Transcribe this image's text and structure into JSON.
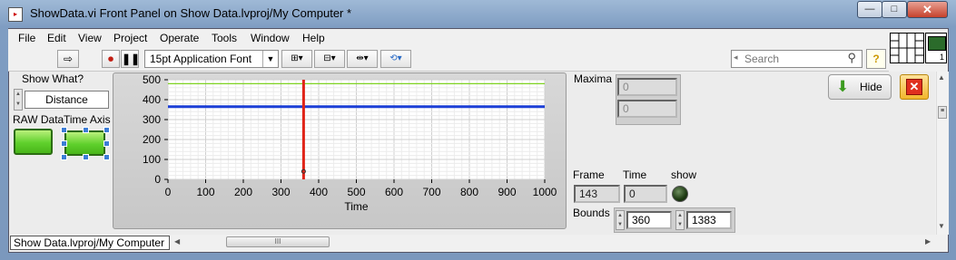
{
  "window": {
    "title": "ShowData.vi Front Panel on Show Data.lvproj/My Computer *",
    "min_glyph": "—",
    "max_glyph": "□",
    "close_glyph": "✕"
  },
  "menu": [
    "File",
    "Edit",
    "View",
    "Project",
    "Operate",
    "Tools",
    "Window",
    "Help"
  ],
  "toolbar": {
    "font_label": "15pt Application Font",
    "search_placeholder": "Search",
    "help_glyph": "?"
  },
  "vi_icon_number": "1",
  "controls": {
    "show_what_label": "Show What?",
    "show_what_value": "Distance",
    "raw_data_label": "RAW Data",
    "time_axis_label": "Time Axis",
    "maxima_label": "Maxima",
    "maxima_values": [
      "0",
      "0"
    ],
    "frame_label": "Frame",
    "frame_value": "143",
    "time_label": "Time",
    "time_value": "0",
    "show_label": "show",
    "bounds_label": "Bounds",
    "bounds_values": [
      "360",
      "1383"
    ],
    "hide_label": "Hide"
  },
  "status": {
    "context": "Show Data.lvproj/My Computer",
    "thumb_glyph": "III"
  },
  "chart_data": {
    "type": "line",
    "xlabel": "Time",
    "ylabel": "",
    "xlim": [
      0,
      1000
    ],
    "ylim": [
      0,
      500
    ],
    "x_ticks": [
      0,
      100,
      200,
      300,
      400,
      500,
      600,
      700,
      800,
      900,
      1000
    ],
    "y_ticks": [
      0,
      100,
      200,
      300,
      400,
      500
    ],
    "grid": true,
    "series": [
      {
        "color": "#7ed321",
        "x": [
          0,
          1000
        ],
        "y": [
          480,
          480
        ]
      },
      {
        "color": "#1c3fd6",
        "x": [
          0,
          1000
        ],
        "y": [
          365,
          365
        ]
      }
    ],
    "cursor": {
      "color": "#e02418",
      "x": 360
    }
  }
}
